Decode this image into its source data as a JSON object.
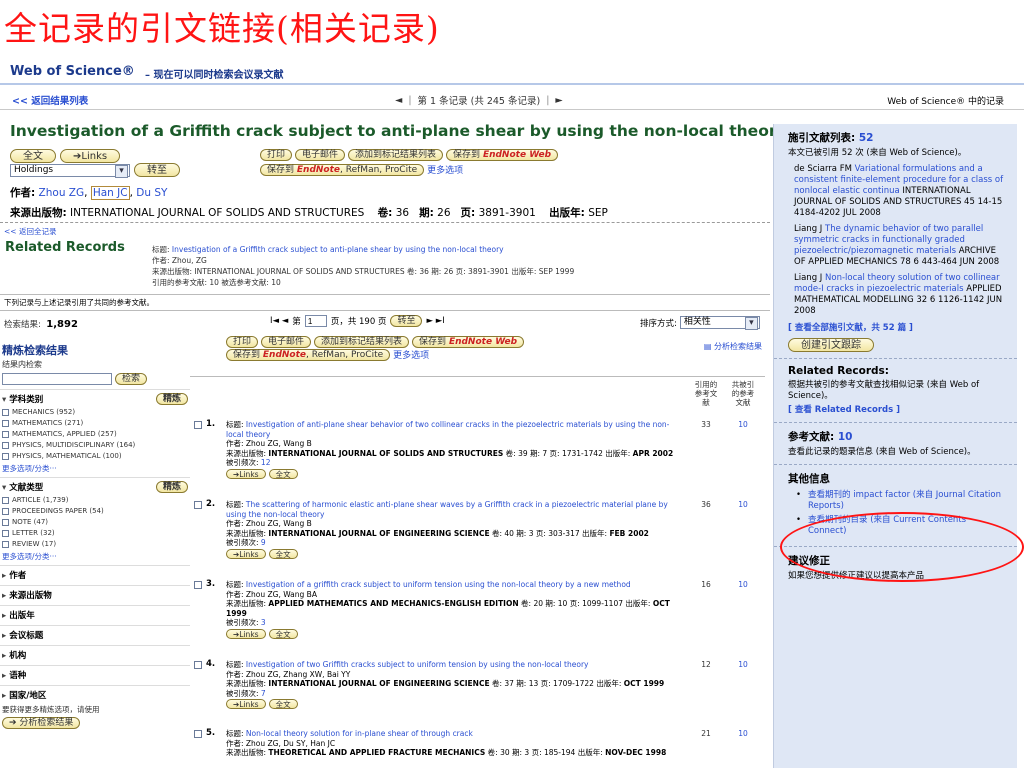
{
  "slide_title": "全记录的引文链接(相关记录)",
  "header": {
    "brand": "Web of Science®",
    "tagline": "– 现在可以同时检索会议录文献"
  },
  "nav": {
    "back": "<< 返回结果列表",
    "prev": "◄",
    "record_info": "第 1 条记录 (共 245 条记录)",
    "next": "►",
    "records_in": "Web of Science® 中的记录"
  },
  "article": {
    "title": "Investigation of a Griffith crack subject to anti-plane shear by using the non-local theory",
    "fulltext": "全文",
    "links": "Links",
    "holdings": "Holdings",
    "go": "转至",
    "print": "打印",
    "email": "电子邮件",
    "add_marked": "添加到标记结果列表",
    "save_to": "保存到",
    "endnote_web": "EndNote Web",
    "save_to2": "保存到",
    "endnote": "EndNote",
    "refman": "RefMan",
    "procite": "ProCite",
    "more_options": "更多选项",
    "authors_label": "作者:",
    "author1": "Zhou ZG",
    "author2": "Han JC",
    "author3": "Du SY",
    "source_label": "来源出版物:",
    "source": "INTERNATIONAL JOURNAL OF SOLIDS AND STRUCTURES",
    "vol_label": "卷:",
    "vol": "36",
    "issue_label": "期:",
    "issue": "26",
    "pages_label": "页:",
    "pages": "3891-3901",
    "year_label": "出版年:",
    "year": "SEP"
  },
  "related": {
    "back": "<< 返回全记录",
    "title": "Related Records",
    "line1_label": "标题:",
    "line1": "Investigation of a Griffith crack subject to anti-plane shear by using the non-local theory",
    "line2": "作者: Zhou, ZG",
    "line3": "来源出版物: INTERNATIONAL JOURNAL OF SOLIDS AND STRUCTURES 卷: 36 期: 26 页: 3891-3901 出版年: SEP 1999",
    "line4": "引用的参考文献: 10 被选参考文献: 10",
    "shared_note": "下列记录与上述记录引用了共同的参考文献。"
  },
  "results": {
    "label": "检索结果:",
    "count": "1,892",
    "first_prev": "I◄ ◄",
    "page_label": "第",
    "page": "1",
    "page_of": "页，共 190 页",
    "go": "转至",
    "next_last": "► ►I",
    "sort_label": "排序方式:",
    "sort_value": "相关性"
  },
  "refine": {
    "title": "精炼检索结果",
    "within": "结果内检索",
    "search_btn": "检索",
    "refine_btn": "精炼",
    "subject_title": "学科类别",
    "subjects": [
      "MECHANICS (952)",
      "MATHEMATICS (271)",
      "MATHEMATICS, APPLIED (257)",
      "PHYSICS, MULTIDISCIPLINARY (164)",
      "PHYSICS, MATHEMATICAL (100)"
    ],
    "more1": "更多选项/分类···",
    "doctype_title": "文献类型",
    "doctypes": [
      "ARTICLE (1,739)",
      "PROCEEDINGS PAPER (54)",
      "NOTE (47)",
      "LETTER (32)",
      "REVIEW (17)"
    ],
    "more2": "更多选项/分类···",
    "collapsed": [
      "作者",
      "来源出版物",
      "出版年",
      "会议标题",
      "机构",
      "语种",
      "国家/地区"
    ],
    "note": "要获得更多精炼选项，请使用",
    "analyze_btn": "分析检索结果"
  },
  "toolbar": {
    "print": "打印",
    "email": "电子邮件",
    "add_marked": "添加到标记结果列表",
    "save_to": "保存到",
    "endnote_web": "EndNote Web",
    "save_to2": "保存到",
    "endnote": "EndNote",
    "refman": "RefMan",
    "procite": "ProCite",
    "more": "更多选项",
    "analyze": "分析检索结果"
  },
  "columns": {
    "cited": "引用的参考文献",
    "shared": "共被引的参考文献"
  },
  "records": [
    {
      "num": "1.",
      "title": "Investigation of anti-plane shear behavior of two collinear cracks in the piezoelectric materials by using the non-local theory",
      "authors": "作者: Zhou ZG, Wang B",
      "src_label": "来源出版物:",
      "src": "INTERNATIONAL JOURNAL OF SOLIDS AND STRUCTURES",
      "src_tail": "卷: 39  期: 7  页: 1731-1742  出版年:",
      "year": "APR 2002",
      "times_label": "被引频次:",
      "times": "12",
      "links": "Links",
      "fulltext": "全文",
      "cited": "33",
      "shared": "10"
    },
    {
      "num": "2.",
      "title": "The scattering of harmonic elastic anti-plane shear waves by a Griffith crack in a piezoelectric material plane by using the non-local theory",
      "authors": "作者: Zhou ZG, Wang B",
      "src_label": "来源出版物:",
      "src": "INTERNATIONAL JOURNAL OF ENGINEERING SCIENCE",
      "src_tail": "卷: 40  期: 3  页: 303-317  出版年:",
      "year": "FEB 2002",
      "times_label": "被引频次:",
      "times": "9",
      "links": "Links",
      "fulltext": "全文",
      "cited": "36",
      "shared": "10"
    },
    {
      "num": "3.",
      "title": "Investigation of a griffith crack subject to uniform tension using the non-local theory by a new method",
      "authors": "作者: Zhou ZG, Wang BA",
      "src_label": "来源出版物:",
      "src": "APPLIED MATHEMATICS AND MECHANICS-ENGLISH EDITION",
      "src_tail": "卷: 20  期: 10  页: 1099-1107  出版年:",
      "year": "OCT 1999",
      "times_label": "被引频次:",
      "times": "3",
      "links": "Links",
      "fulltext": "全文",
      "cited": "16",
      "shared": "10"
    },
    {
      "num": "4.",
      "title": "Investigation of two Griffith cracks subject to uniform tension by using the non-local theory",
      "authors": "作者: Zhou ZG, Zhang XW, Bai YY",
      "src_label": "来源出版物:",
      "src": "INTERNATIONAL JOURNAL OF ENGINEERING SCIENCE",
      "src_tail": "卷: 37  期: 13  页: 1709-1722  出版年:",
      "year": "OCT 1999",
      "times_label": "被引频次:",
      "times": "7",
      "links": "Links",
      "fulltext": "全文",
      "cited": "12",
      "shared": "10"
    },
    {
      "num": "5.",
      "title": "Non-local theory solution for in-plane shear of through crack",
      "authors": "作者: Zhou ZG, Du SY, Han JC",
      "src_label": "来源出版物:",
      "src": "THEORETICAL AND APPLIED FRACTURE MECHANICS",
      "src_tail": "卷: 30  期: 3  页: 185-194  出版年:",
      "year": "NOV-DEC 1998",
      "times_label": "",
      "times": "",
      "links": "",
      "fulltext": "",
      "cited": "21",
      "shared": "10"
    }
  ],
  "right": {
    "cited_title": "施引文献列表:",
    "cited_count": "52",
    "cited_text": "本文已被引用 52 次 (来自 Web of Science)。",
    "cites": [
      {
        "author": "de Sciarra FM",
        "title": "Variational formulations and a consistent finite-element procedure for a class of nonlocal elastic continua",
        "rest": "INTERNATIONAL JOURNAL OF SOLIDS AND STRUCTURES 45 14-15 4184-4202 JUL 2008"
      },
      {
        "author": "Liang J",
        "title": "The dynamic behavior of two parallel symmetric cracks in functionally graded piezoelectric/piezomagnetic materials",
        "rest": "ARCHIVE OF APPLIED MECHANICS 78 6 443-464 JUN 2008"
      },
      {
        "author": "Liang J",
        "title": "Non-local theory solution of two collinear mode-I cracks in piezoelectric materials",
        "rest": "APPLIED MATHEMATICAL MODELLING 32 6 1126-1142 JUN 2008"
      }
    ],
    "view_all": "[ 查看全部施引文献，共 52 篇 ]",
    "alert_btn": "创建引文跟踪",
    "related_title": "Related Records:",
    "related_text": "根据共被引的参考文献查找相似记录 (来自 Web of Science)。",
    "related_link": "[ 查看 Related Records ]",
    "refs_title": "参考文献:",
    "refs_count": "10",
    "refs_text": "查看此记录的题录信息 (来自 Web of Science)。",
    "other_title": "其他信息",
    "other": [
      "查看期刊的 impact factor (来自 Journal Citation Reports)",
      "查看期刊的目录 (来自 Current Contents Connect)"
    ],
    "suggest_title": "建议修正",
    "suggest_text": "如果您想提供修正建议以提高本产品"
  }
}
